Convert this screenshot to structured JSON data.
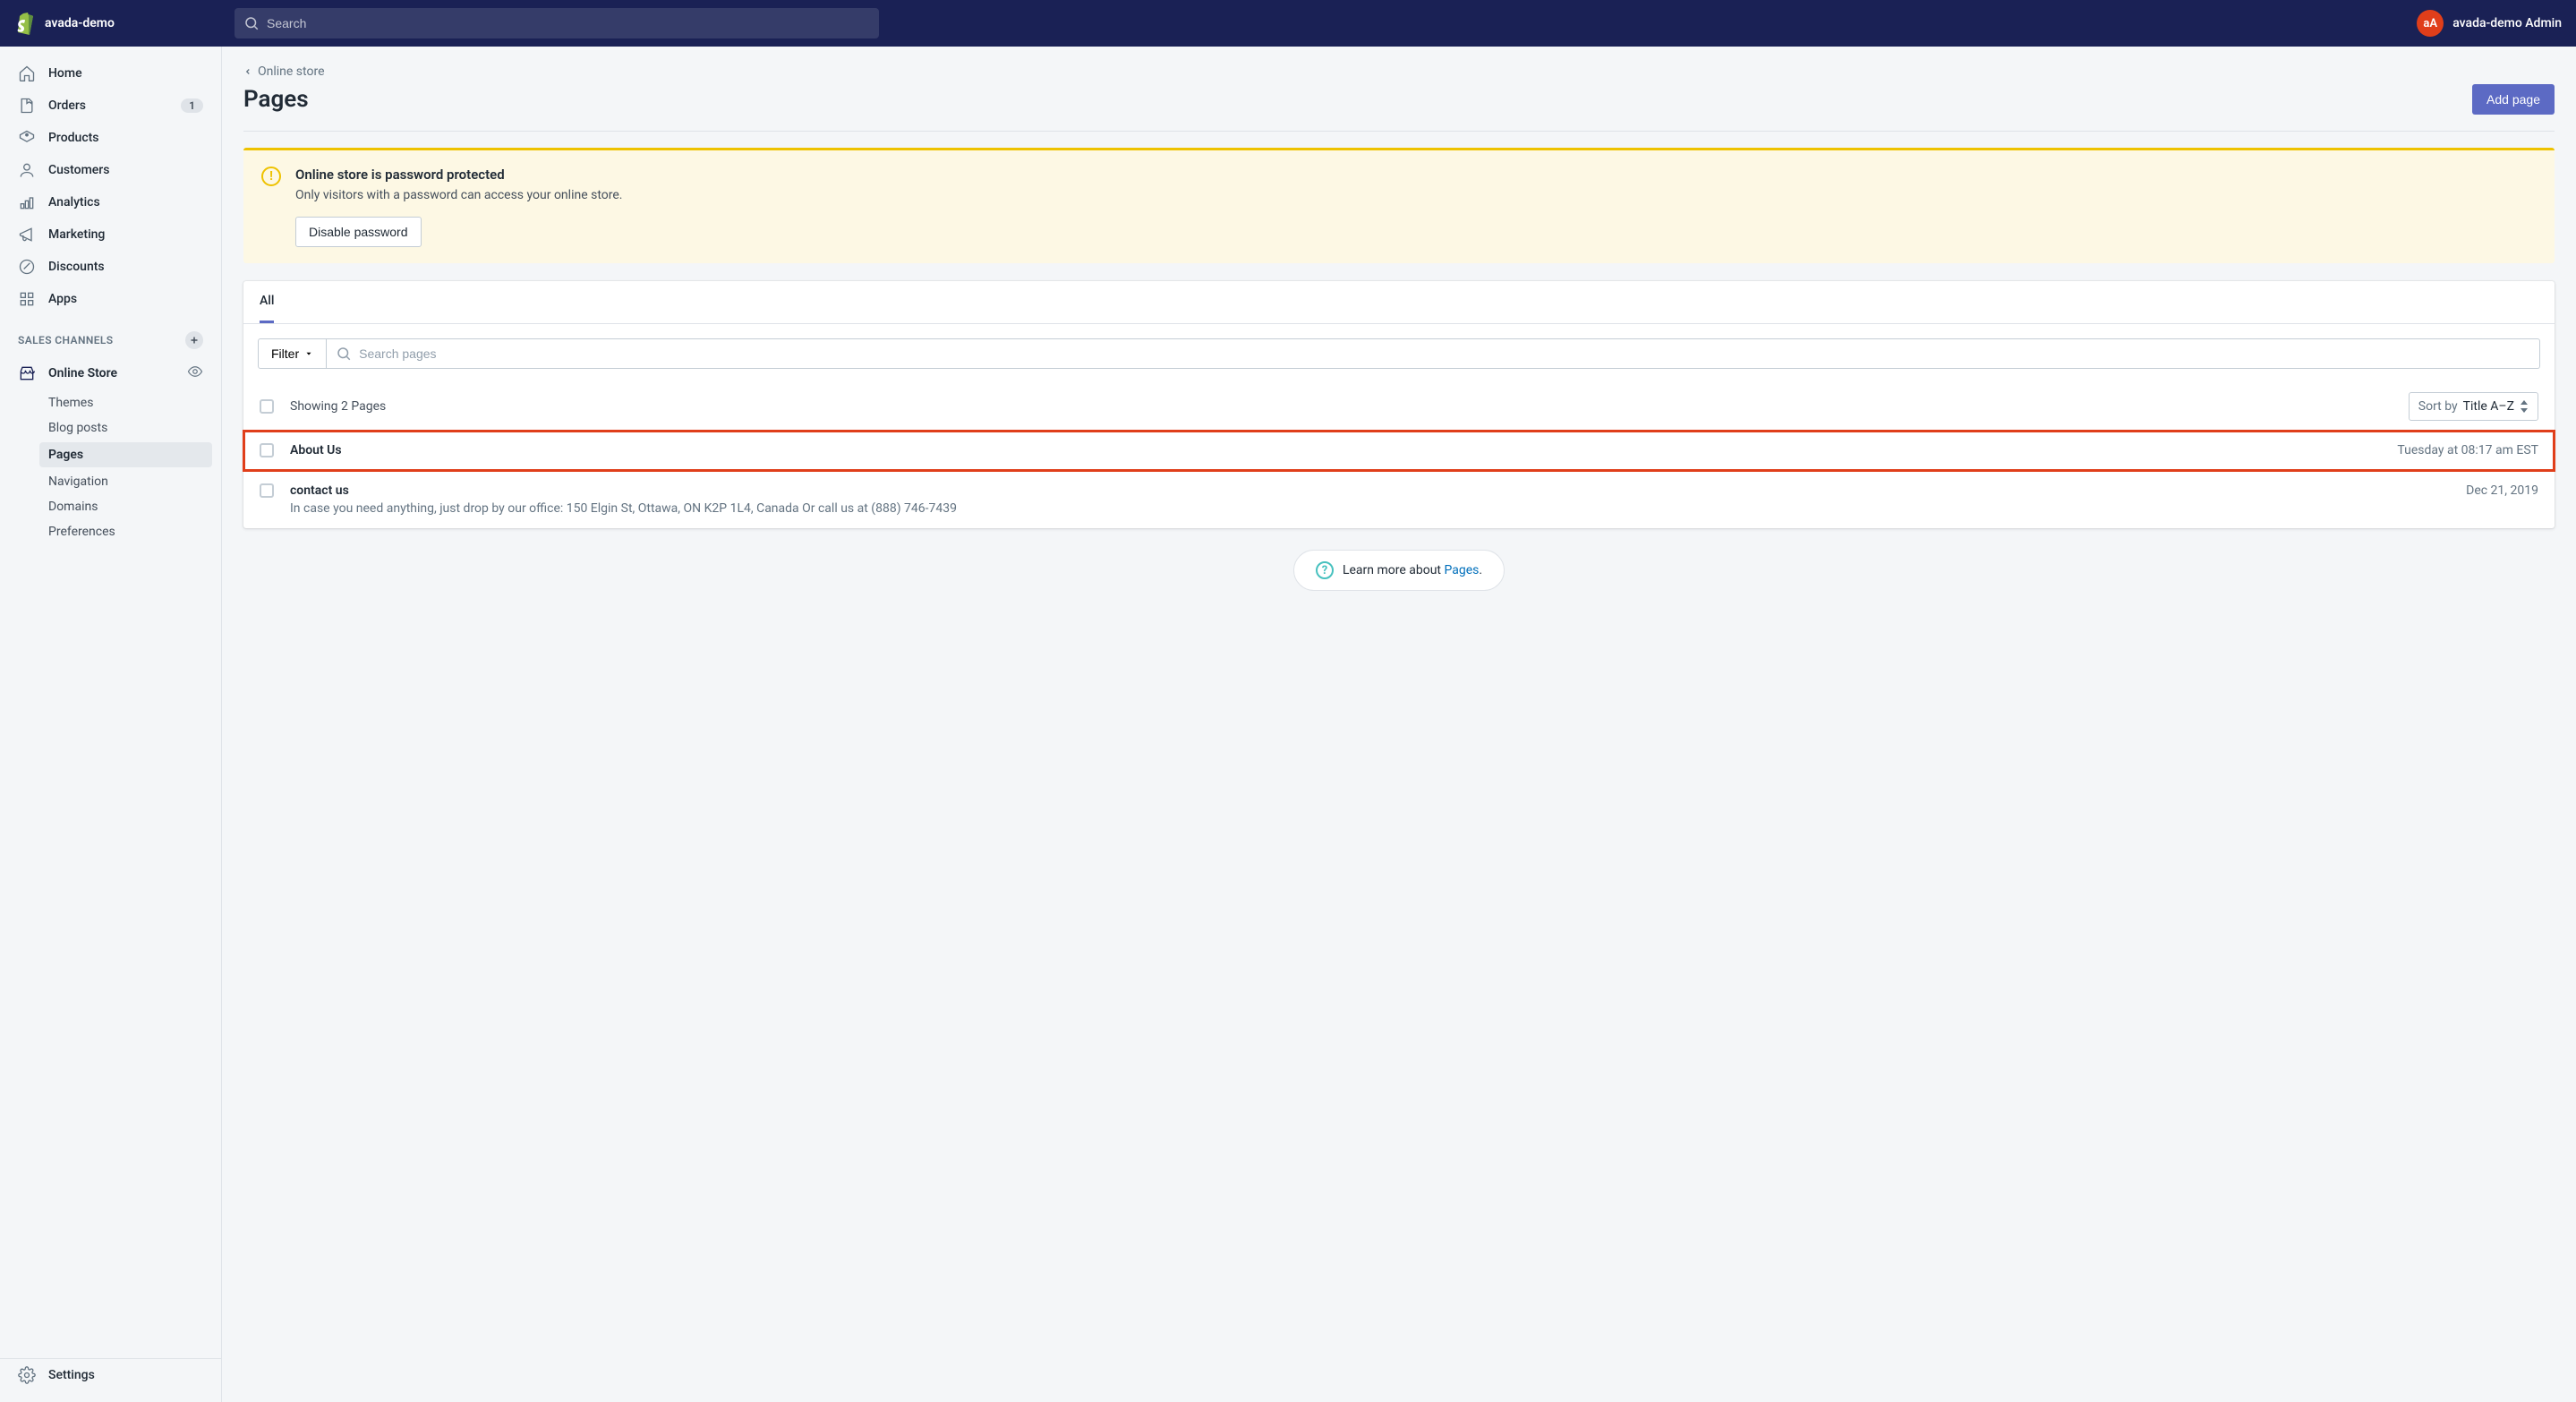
{
  "topbar": {
    "store_name": "avada-demo",
    "search_placeholder": "Search",
    "user_initials": "aA",
    "user_label": "avada-demo Admin"
  },
  "sidebar": {
    "nav": [
      {
        "id": "home",
        "label": "Home"
      },
      {
        "id": "orders",
        "label": "Orders",
        "badge": "1"
      },
      {
        "id": "products",
        "label": "Products"
      },
      {
        "id": "customers",
        "label": "Customers"
      },
      {
        "id": "analytics",
        "label": "Analytics"
      },
      {
        "id": "marketing",
        "label": "Marketing"
      },
      {
        "id": "discounts",
        "label": "Discounts"
      },
      {
        "id": "apps",
        "label": "Apps"
      }
    ],
    "section_label": "SALES CHANNELS",
    "channel": {
      "label": "Online Store"
    },
    "subnav": [
      {
        "label": "Themes"
      },
      {
        "label": "Blog posts"
      },
      {
        "label": "Pages",
        "active": true
      },
      {
        "label": "Navigation"
      },
      {
        "label": "Domains"
      },
      {
        "label": "Preferences"
      }
    ],
    "settings_label": "Settings"
  },
  "crumb": {
    "label": "Online store"
  },
  "page": {
    "title": "Pages",
    "add_button": "Add page"
  },
  "banner": {
    "title": "Online store is password protected",
    "desc": "Only visitors with a password can access your online store.",
    "action": "Disable password"
  },
  "tab_all": "All",
  "filter": {
    "label": "Filter",
    "search_placeholder": "Search pages"
  },
  "list": {
    "showing": "Showing 2 Pages",
    "sort_prefix": "Sort by",
    "sort_value": "Title A–Z",
    "rows": [
      {
        "title": "About Us",
        "meta": "Tuesday at 08:17 am EST",
        "highlighted": true
      },
      {
        "title": "contact us",
        "meta": "Dec 21, 2019",
        "sub": "In case you need anything, just drop by our office: 150 Elgin St, Ottawa, ON K2P 1L4, Canada Or call us at (888) 746-7439"
      }
    ]
  },
  "learn": {
    "prefix": "Learn more about ",
    "link": "Pages",
    "suffix": "."
  }
}
